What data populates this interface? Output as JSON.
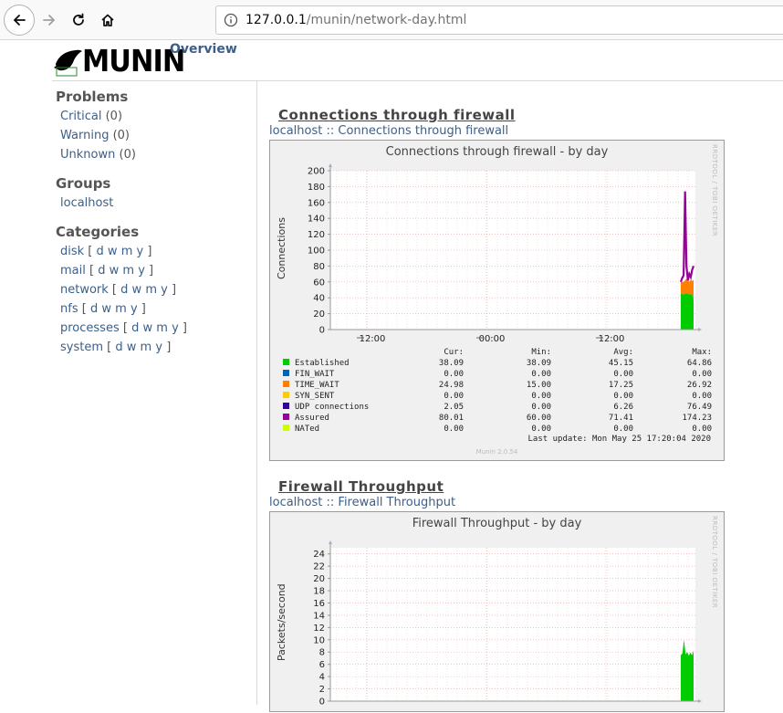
{
  "browser": {
    "url_host": "127.0.0.1",
    "url_path": "/munin/network-day.html"
  },
  "header": {
    "logo_text": "MUNIN",
    "overview_link": "Overview"
  },
  "sidebar": {
    "problems_heading": "Problems",
    "problems": [
      {
        "label": "Critical",
        "count": "(0)"
      },
      {
        "label": "Warning",
        "count": "(0)"
      },
      {
        "label": "Unknown",
        "count": "(0)"
      }
    ],
    "groups_heading": "Groups",
    "groups": [
      "localhost"
    ],
    "categories_heading": "Categories",
    "categories": [
      "disk",
      "mail",
      "network",
      "nfs",
      "processes",
      "system"
    ],
    "period_links": [
      "d",
      "w",
      "m",
      "y"
    ]
  },
  "graphs": [
    {
      "section_title": "Connections through firewall",
      "breadcrumb_host": "localhost",
      "breadcrumb_sep": "::",
      "breadcrumb_name": "Connections through firewall",
      "image_title": "Connections through firewall - by day",
      "rrd_credit": "RRDTOOL / TOBI OETIKER",
      "ylabel": "Connections",
      "yticks": [
        "200",
        "180",
        "160",
        "140",
        "120",
        "100",
        "80",
        "60",
        "40",
        "20",
        "0"
      ],
      "xticks": [
        "12:00",
        "00:00",
        "12:00"
      ],
      "legend_headers": [
        "Cur:",
        "Min:",
        "Avg:",
        "Max:"
      ],
      "legend": [
        {
          "name": "Established",
          "color": "#00cc00",
          "cur": "38.09",
          "min": "38.09",
          "avg": "45.15",
          "max": "64.86"
        },
        {
          "name": "FIN_WAIT",
          "color": "#0066b3",
          "cur": "0.00",
          "min": "0.00",
          "avg": "0.00",
          "max": "0.00"
        },
        {
          "name": "TIME_WAIT",
          "color": "#ff8000",
          "cur": "24.98",
          "min": "15.00",
          "avg": "17.25",
          "max": "26.92"
        },
        {
          "name": "SYN_SENT",
          "color": "#ffcc00",
          "cur": "0.00",
          "min": "0.00",
          "avg": "0.00",
          "max": "0.00"
        },
        {
          "name": "UDP connections",
          "color": "#330099",
          "cur": "2.05",
          "min": "0.00",
          "avg": "6.26",
          "max": "76.49"
        },
        {
          "name": "Assured",
          "color": "#990099",
          "cur": "80.01",
          "min": "60.00",
          "avg": "71.41",
          "max": "174.23"
        },
        {
          "name": "NATed",
          "color": "#ccff00",
          "cur": "0.00",
          "min": "0.00",
          "avg": "0.00",
          "max": "0.00"
        }
      ],
      "last_update": "Last update: Mon May 25 17:20:04 2020",
      "munin_version": "Munin 2.0.54"
    },
    {
      "section_title": "Firewall Throughput",
      "breadcrumb_host": "localhost",
      "breadcrumb_sep": "::",
      "breadcrumb_name": "Firewall Throughput",
      "image_title": "Firewall Throughput - by day",
      "rrd_credit": "RRDTOOL / TOBI OETIKER",
      "ylabel": "Packets/second",
      "yticks": [
        "24",
        "22",
        "20",
        "18",
        "16",
        "14",
        "12",
        "10",
        "8",
        "6",
        "4",
        "2",
        "0"
      ]
    }
  ],
  "chart_data": [
    {
      "type": "area",
      "title": "Connections through firewall - by day",
      "ylabel": "Connections",
      "ylim": [
        0,
        200
      ],
      "x_ticks": [
        "12:00",
        "00:00",
        "12:00"
      ],
      "series": [
        {
          "name": "Established",
          "color": "#00cc00",
          "x": [
            0,
            1,
            2,
            3,
            4,
            5,
            6,
            7,
            8,
            9
          ],
          "values": [
            45,
            45,
            44,
            45,
            46,
            45,
            44,
            45,
            44,
            38
          ]
        },
        {
          "name": "TIME_WAIT",
          "color": "#ff8000",
          "x": [
            0,
            1,
            2,
            3,
            4,
            5,
            6,
            7,
            8,
            9
          ],
          "values": [
            15,
            15,
            16,
            17,
            18,
            17,
            16,
            18,
            17,
            25
          ]
        },
        {
          "name": "Assured",
          "color": "#990099",
          "x": [
            0,
            1,
            2,
            3,
            4,
            5,
            6,
            7,
            8,
            9
          ],
          "values": [
            60,
            65,
            68,
            174,
            80,
            62,
            70,
            66,
            75,
            80
          ]
        }
      ],
      "grid": true
    },
    {
      "type": "area",
      "title": "Firewall Throughput - by day",
      "ylabel": "Packets/second",
      "ylim": [
        0,
        25
      ],
      "series": [
        {
          "name": "",
          "color": "#00cc00",
          "x": [
            0,
            1,
            2,
            3,
            4,
            5,
            6,
            7,
            8
          ],
          "values": [
            7.5,
            7.8,
            10,
            7.6,
            8,
            7.4,
            7.9,
            7.5,
            8.2
          ]
        }
      ],
      "grid": true
    }
  ]
}
